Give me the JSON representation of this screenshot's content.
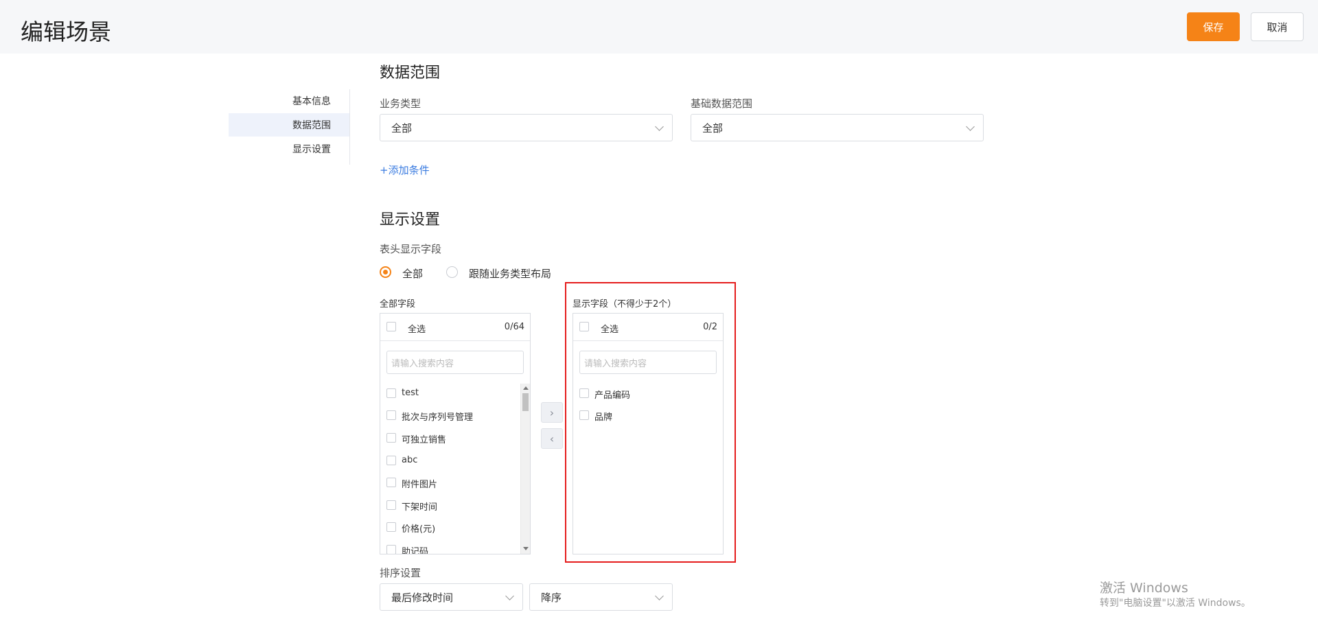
{
  "header": {
    "title": "编辑场景",
    "save_label": "保存",
    "cancel_label": "取消"
  },
  "sidenav": {
    "items": [
      {
        "label": "基本信息"
      },
      {
        "label": "数据范围",
        "active": true
      },
      {
        "label": "显示设置"
      }
    ]
  },
  "data_scope": {
    "title": "数据范围",
    "business_type": {
      "label": "业务类型",
      "value": "全部"
    },
    "base_range": {
      "label": "基础数据范围",
      "value": "全部"
    },
    "add_condition": "+添加条件"
  },
  "display": {
    "title": "显示设置",
    "header_fields_label": "表头显示字段",
    "options": [
      {
        "label": "全部",
        "checked": true
      },
      {
        "label": "跟随业务类型布局",
        "checked": false
      }
    ],
    "all_fields": {
      "caption": "全部字段",
      "select_all": "全选",
      "count": "0/64",
      "search_placeholder": "请输入搜索内容",
      "items": [
        "test",
        "批次与序列号管理",
        "可独立销售",
        "abc",
        "附件图片",
        "下架时间",
        "价格(元)",
        "助记码"
      ]
    },
    "shown_fields": {
      "caption": "显示字段（不得少于2个）",
      "select_all": "全选",
      "count": "0/2",
      "search_placeholder": "请输入搜索内容",
      "items": [
        "产品编码",
        "品牌"
      ]
    },
    "transfer": {
      "right": "›",
      "left": "‹"
    },
    "sort": {
      "label": "排序设置",
      "field": "最后修改时间",
      "order": "降序"
    }
  },
  "watermark": {
    "title": "激活 Windows",
    "subtitle": "转到\"电脑设置\"以激活 Windows。"
  },
  "colors": {
    "accent": "#f58317",
    "link": "#3a7be0",
    "highlight": "#e51b1b"
  }
}
